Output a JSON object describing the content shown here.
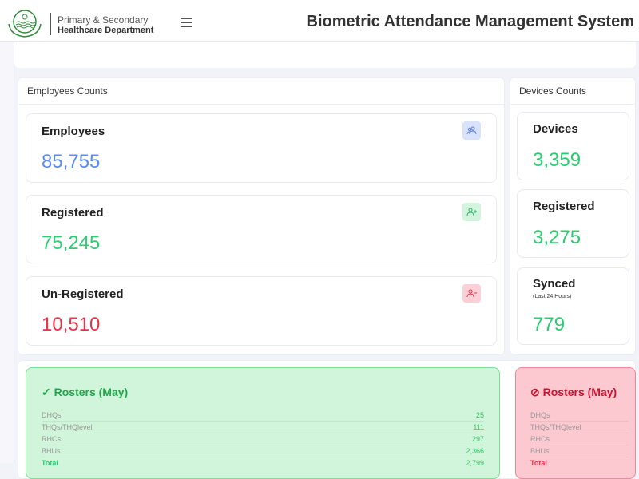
{
  "header": {
    "org_line1": "Primary & Secondary",
    "org_line2": "Healthcare Department",
    "title": "Biometric Attendance Management System"
  },
  "employees": {
    "panel_title": "Employees Counts",
    "cards": [
      {
        "label": "Employees",
        "value": "85,755",
        "color": "#5b8def",
        "icon": "users-icon"
      },
      {
        "label": "Registered",
        "value": "75,245",
        "color": "#2ecc71",
        "icon": "user-plus-icon"
      },
      {
        "label": "Un-Registered",
        "value": "10,510",
        "color": "#e8344a",
        "icon": "user-minus-icon"
      }
    ]
  },
  "devices": {
    "panel_title": "Devices Counts",
    "cards": [
      {
        "label": "Devices",
        "value": "3,359"
      },
      {
        "label": "Registered",
        "value": "3,275"
      },
      {
        "label": "Synced",
        "sublabel": "(Last 24 Hours)",
        "value": "779"
      }
    ]
  },
  "rosters_done": {
    "icon": "check-icon",
    "title": "Rosters (May)",
    "rows": [
      {
        "label": "DHQs",
        "value": "25"
      },
      {
        "label": "THQs/THQlevel",
        "value": "111"
      },
      {
        "label": "RHCs",
        "value": "297"
      },
      {
        "label": "BHUs",
        "value": "2,366"
      }
    ],
    "total_label": "Total",
    "total_value": "2,799"
  },
  "rosters_missing": {
    "icon": "ban-icon",
    "title": "Rosters (May)",
    "rows": [
      {
        "label": "DHQs"
      },
      {
        "label": "THQs/THQlevel"
      },
      {
        "label": "RHCs"
      },
      {
        "label": "BHUs"
      }
    ],
    "total_label": "Total"
  }
}
